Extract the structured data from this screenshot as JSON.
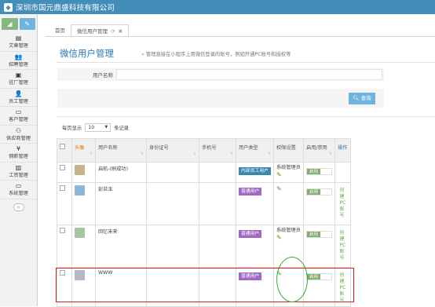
{
  "app": {
    "title": "深圳市国元鼎盛科技有限公司",
    "logo_icon": "company-logo-icon"
  },
  "sidebar": {
    "items": [
      {
        "label": "文章管理",
        "icon": "document-icon",
        "glyph": "▤"
      },
      {
        "label": "招聘管理",
        "icon": "user-add-icon",
        "glyph": "👥"
      },
      {
        "label": "驻厂管理",
        "icon": "badge-icon",
        "glyph": "▣"
      },
      {
        "label": "员工管理",
        "icon": "user-icon",
        "glyph": "👤"
      },
      {
        "label": "客户管理",
        "icon": "id-card-icon",
        "glyph": "▭"
      },
      {
        "label": "供应商管理",
        "icon": "handshake-icon",
        "glyph": "⚇"
      },
      {
        "label": "佣薪管理",
        "icon": "yen-icon",
        "glyph": "¥"
      },
      {
        "label": "工资管理",
        "icon": "money-icon",
        "glyph": "▥"
      },
      {
        "label": "系统管理",
        "icon": "desktop-icon",
        "glyph": "▭"
      }
    ],
    "collapse_glyph": "«"
  },
  "tabs": [
    {
      "label": "首页",
      "active": false
    },
    {
      "label": "微信用户管理",
      "active": true,
      "refresh_glyph": "⟳",
      "close_glyph": "✖"
    }
  ],
  "page": {
    "title": "微信用户管理",
    "subtitle": "管理直接在小程序上用微信登录的账号，例如开通PC账号和授权等",
    "subtitle_chevron": "»"
  },
  "search": {
    "user_name_label": "用户名称",
    "user_name_value": "",
    "query_button": "查询",
    "query_icon": "search-icon"
  },
  "pagination": {
    "prefix": "每页显示",
    "page_size": "10",
    "suffix": "条记录"
  },
  "table": {
    "headers": [
      "",
      "头像",
      "用户名称",
      "身份证号",
      "手机号",
      "用户类型",
      "权限设置",
      "启用/禁用",
      "操作"
    ],
    "rows": [
      {
        "name": "启航-(刷成功)",
        "id_no": "",
        "phone": "",
        "type": "内部员工用户",
        "type_color": "#3a87ad",
        "perm": "系统管理员",
        "perm_icon": "pencil-icon",
        "status": "启用",
        "op": "",
        "avatar_color": "#c9b48a"
      },
      {
        "name": "彭苔玉",
        "id_no": "",
        "phone": "",
        "type": "普通用户",
        "type_color": "#a069c3",
        "perm": "",
        "perm_icon": "pencil-icon",
        "status": "启用",
        "op": "创建PC账号",
        "avatar_color": "#8fb6d8"
      },
      {
        "name": "回忆未来",
        "id_no": "",
        "phone": "",
        "type": "普通用户",
        "type_color": "#a069c3",
        "perm": "系统管理员",
        "perm_icon": "pencil-icon",
        "status": "启用",
        "op": "创建PC账号",
        "avatar_color": "#a7c6a0"
      },
      {
        "name": "WWW",
        "id_no": "",
        "phone": "",
        "type": "普通用户",
        "type_color": "#a069c3",
        "perm": "",
        "perm_icon": "pencil-icon",
        "status": "启用",
        "op": "创建PC账号",
        "avatar_color": "#b3b8c4"
      }
    ]
  },
  "colors": {
    "topbar": "#438eb9",
    "link": "#2679b5",
    "enable": "#82af6f",
    "highlight_red": "#e02020",
    "highlight_green": "#39a935"
  }
}
